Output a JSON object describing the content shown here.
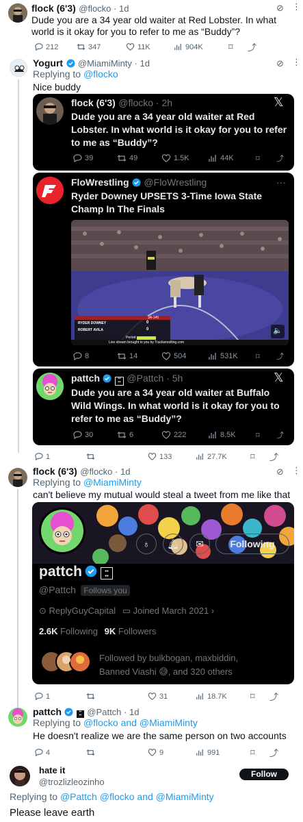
{
  "tweets": [
    {
      "name": "flock (6'3)",
      "handle": "@flocko · 1d",
      "text": "Dude you are a 34 year old waiter at Red Lobster. In what world is it okay for you to refer to me as “Buddy”?",
      "stats": {
        "replies": "212",
        "retweets": "347",
        "likes": "11K",
        "views": "904K"
      }
    },
    {
      "name": "Yogurt",
      "handle": "@MiamiMinty · 1d",
      "replying_prefix": "Replying to ",
      "replying_to": "@flocko",
      "text": "Nice buddy",
      "stats": {
        "replies": "1",
        "retweets": "",
        "likes": "133",
        "views": "27.7K"
      }
    },
    {
      "name": "flock (6'3)",
      "handle": "@flocko · 1d",
      "replying_prefix": "Replying to ",
      "replying_to": "@MiamiMinty",
      "text": "can't believe my mutual would steal a tweet from me like that",
      "stats": {
        "replies": "1",
        "retweets": "",
        "likes": "31",
        "views": "18.7K"
      }
    },
    {
      "name": "pattch",
      "handle": "@Pattch · 1d",
      "replying_prefix": "Replying to ",
      "replying_to": "@flocko and @MiamiMinty",
      "text": "He doesn't realize we are the same person on two accounts",
      "stats": {
        "replies": "4",
        "retweets": "",
        "likes": "9",
        "views": "991"
      }
    },
    {
      "name": "hate it",
      "handle": "@trozlizleozinho",
      "follow_label": "Follow",
      "replying_prefix": "Replying to ",
      "replying_to": "@Pattch @flocko and @MiamiMinty",
      "text": "Please leave earth"
    }
  ],
  "embeds": [
    {
      "name": "flock (6'3)",
      "handle": "@flocko · 2h",
      "text": "Dude you are a 34 year old waiter at Red Lobster. In what world is it okay for you to refer to me as “Buddy”?",
      "stats": {
        "replies": "39",
        "retweets": "49",
        "likes": "1.5K",
        "views": "44K"
      }
    },
    {
      "name": "FloWrestling",
      "handle": "@FloWrestling",
      "text": "Ryder Downey UPSETS 3-Time Iowa State Champ In The Finals",
      "more": "···",
      "video": {
        "score_rows": [
          {
            "name": "RYDER DOWNEY",
            "score": "0"
          },
          {
            "name": "ROBERT AVILA",
            "score": "0"
          }
        ],
        "weight": "3A-145",
        "period": "Period",
        "stream": "Live stream brought to you by Trackwrestling.com"
      },
      "stats": {
        "replies": "8",
        "retweets": "14",
        "likes": "504",
        "views": "531K"
      }
    },
    {
      "name": "pattch",
      "handle": "@Pattch · 5h",
      "text": "Dude you are a 34 year old waiter at Buffalo Wild Wings. In what world is it okay for you to refer to me as “Buddy”?",
      "stats": {
        "replies": "30",
        "retweets": "6",
        "likes": "222",
        "views": "8.5K"
      }
    }
  ],
  "profile": {
    "name": "pattch",
    "handle": "@Pattch",
    "follows_you": "Follows you",
    "following_btn": "Following",
    "location": "ReplyGuyCapital",
    "joined": "Joined March 2021",
    "following_count": "2.6K",
    "following_label": "Following",
    "followers_count": "9K",
    "followers_label": "Followers",
    "followed_by": "Followed by bulkbogan, maxbiddin, Banned Viashi 😅, and 320 others"
  },
  "colors": {
    "link": "#1d9bf0",
    "card_bg": "#000000",
    "muted": "#536471",
    "verified": "#1d9bf0",
    "flo_red": "#e8232c"
  }
}
